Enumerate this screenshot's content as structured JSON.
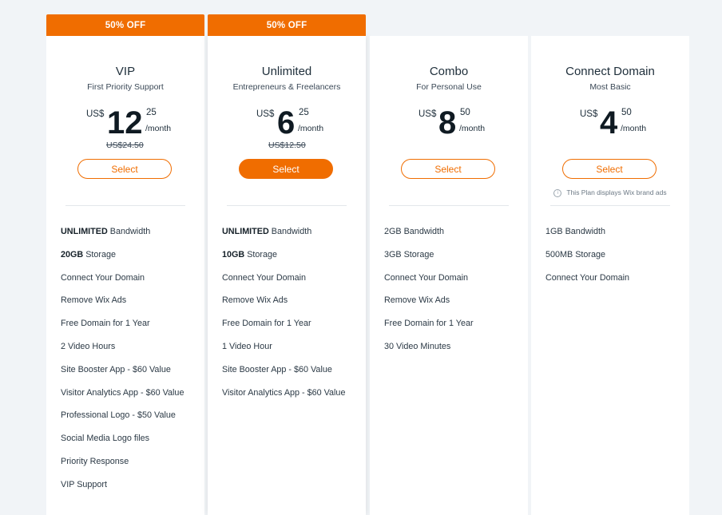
{
  "plans": [
    {
      "badge": "50% OFF",
      "name": "VIP",
      "subtitle": "First Priority Support",
      "currency": "US$",
      "price_whole": "12",
      "price_cents": "25",
      "period": "/month",
      "original_price": "US$24.50",
      "button_label": "Select",
      "features": [
        {
          "bold": "UNLIMITED",
          "text": " Bandwidth"
        },
        {
          "bold": "20GB",
          "text": " Storage"
        },
        {
          "bold": "",
          "text": "Connect Your Domain"
        },
        {
          "bold": "",
          "text": "Remove Wix Ads"
        },
        {
          "bold": "",
          "text": "Free Domain for 1 Year"
        },
        {
          "bold": "",
          "text": "2 Video Hours"
        },
        {
          "bold": "",
          "text": "Site Booster App - $60 Value"
        },
        {
          "bold": "",
          "text": "Visitor Analytics App - $60 Value"
        },
        {
          "bold": "",
          "text": "Professional Logo - $50 Value"
        },
        {
          "bold": "",
          "text": "Social Media Logo files"
        },
        {
          "bold": "",
          "text": "Priority Response"
        },
        {
          "bold": "",
          "text": "VIP Support"
        }
      ]
    },
    {
      "badge": "50% OFF",
      "name": "Unlimited",
      "subtitle": "Entrepreneurs & Freelancers",
      "currency": "US$",
      "price_whole": "6",
      "price_cents": "25",
      "period": "/month",
      "original_price": "US$12.50",
      "button_label": "Select",
      "features": [
        {
          "bold": "UNLIMITED",
          "text": " Bandwidth"
        },
        {
          "bold": "10GB",
          "text": " Storage"
        },
        {
          "bold": "",
          "text": "Connect Your Domain"
        },
        {
          "bold": "",
          "text": "Remove Wix Ads"
        },
        {
          "bold": "",
          "text": "Free Domain for 1 Year"
        },
        {
          "bold": "",
          "text": "1 Video Hour"
        },
        {
          "bold": "",
          "text": "Site Booster App - $60 Value"
        },
        {
          "bold": "",
          "text": "Visitor Analytics App - $60 Value"
        }
      ]
    },
    {
      "name": "Combo",
      "subtitle": "For Personal Use",
      "currency": "US$",
      "price_whole": "8",
      "price_cents": "50",
      "period": "/month",
      "button_label": "Select",
      "features": [
        {
          "bold": "",
          "text": "2GB Bandwidth"
        },
        {
          "bold": "",
          "text": "3GB Storage"
        },
        {
          "bold": "",
          "text": "Connect Your Domain"
        },
        {
          "bold": "",
          "text": "Remove Wix Ads"
        },
        {
          "bold": "",
          "text": "Free Domain for 1 Year"
        },
        {
          "bold": "",
          "text": "30 Video Minutes"
        }
      ]
    },
    {
      "name": "Connect Domain",
      "subtitle": "Most Basic",
      "currency": "US$",
      "price_whole": "4",
      "price_cents": "50",
      "period": "/month",
      "button_label": "Select",
      "note": "This Plan displays Wix brand ads",
      "features": [
        {
          "bold": "",
          "text": "1GB Bandwidth"
        },
        {
          "bold": "",
          "text": "500MB Storage"
        },
        {
          "bold": "",
          "text": "Connect Your Domain"
        }
      ]
    }
  ],
  "colors": {
    "accent": "#f06d00",
    "background": "#f1f4f7",
    "card": "#ffffff"
  }
}
